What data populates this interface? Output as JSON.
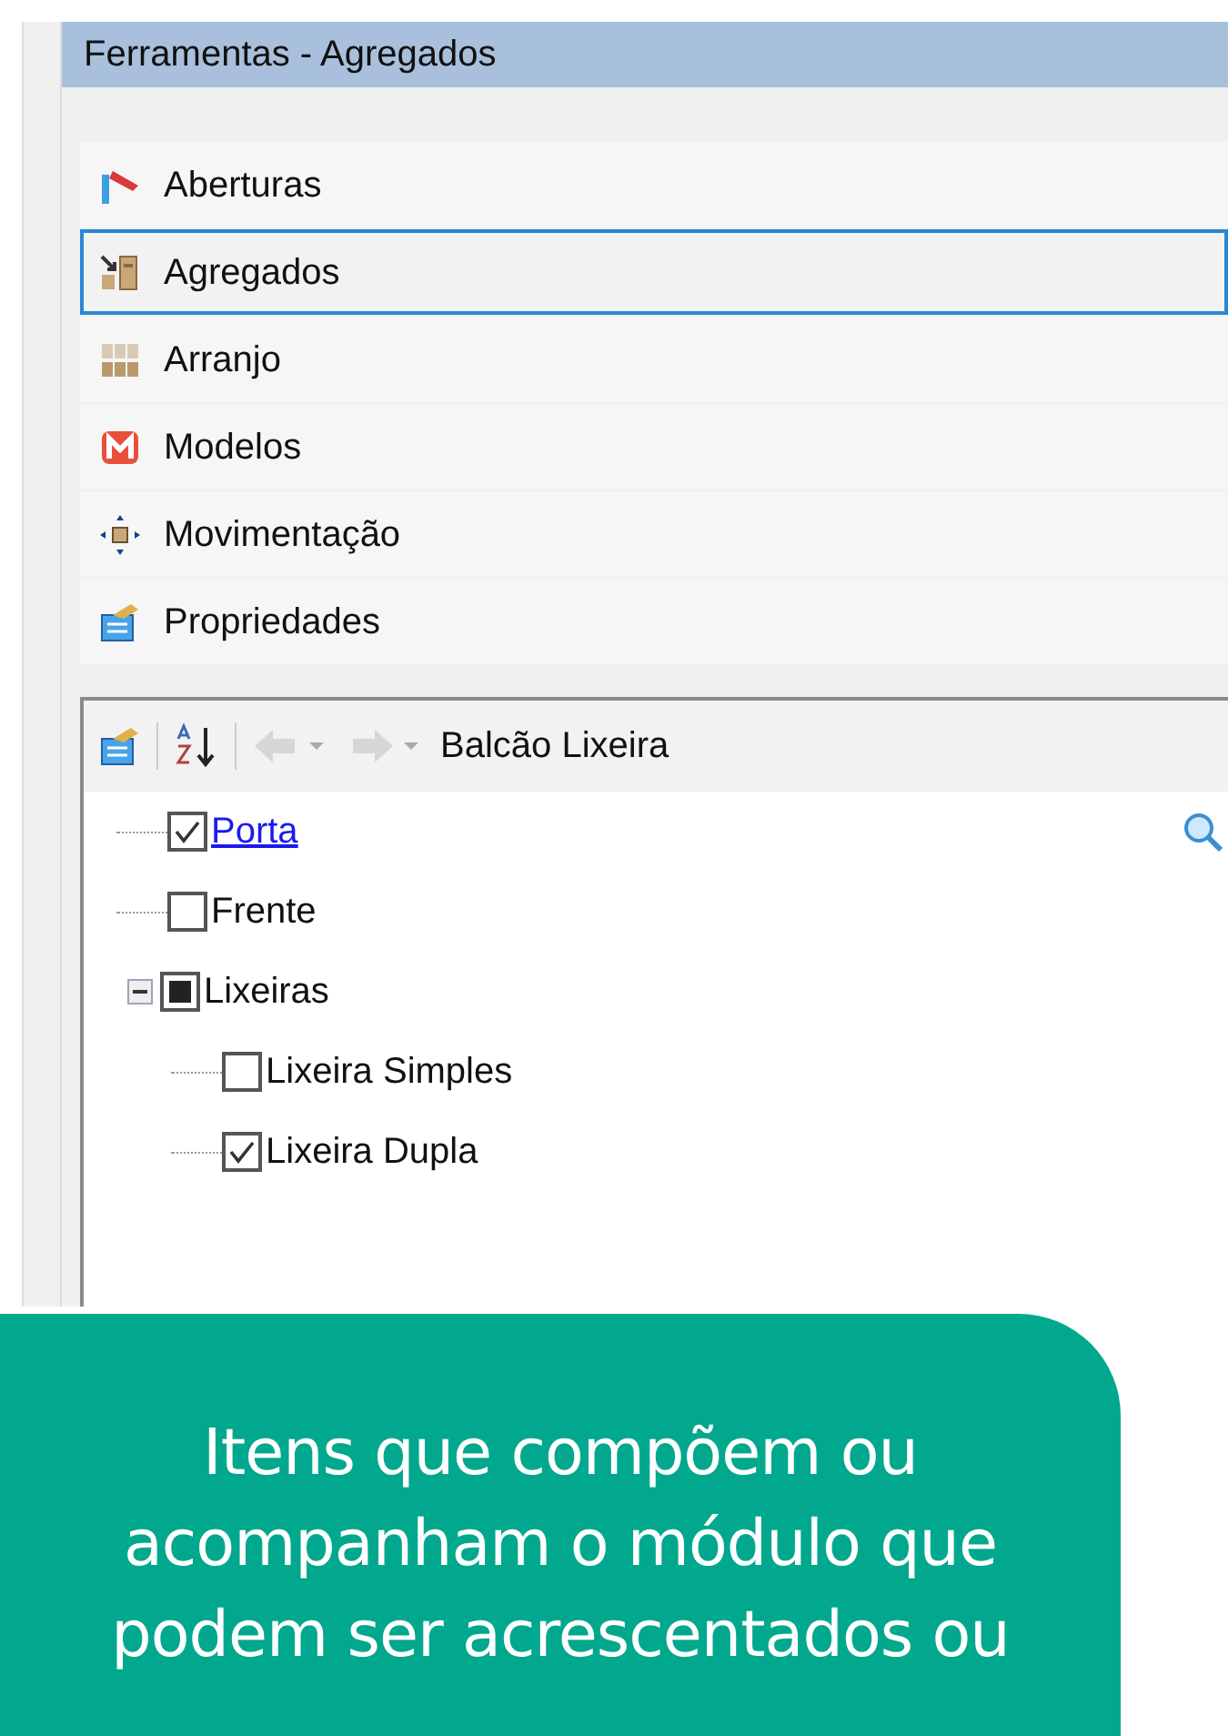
{
  "panel": {
    "title": "Ferramentas - Agregados"
  },
  "tools": [
    {
      "label": "Aberturas",
      "kind": "flag",
      "selected": false
    },
    {
      "label": "Agregados",
      "kind": "aggregate",
      "selected": true
    },
    {
      "label": "Arranjo",
      "kind": "grid",
      "selected": false
    },
    {
      "label": "Modelos",
      "kind": "m",
      "selected": false
    },
    {
      "label": "Movimentação",
      "kind": "move",
      "selected": false
    },
    {
      "label": "Propriedades",
      "kind": "props",
      "selected": false
    }
  ],
  "tree_toolbar": {
    "path": "Balcão Lixeira"
  },
  "tree": [
    {
      "label": "Porta",
      "kind": "link",
      "checked": true,
      "indeterminate": false
    },
    {
      "label": "Frente",
      "kind": "plain",
      "checked": false,
      "indeterminate": false
    },
    {
      "label": "Lixeiras",
      "kind": "plain",
      "checked": false,
      "indeterminate": true,
      "expanded": true,
      "children": [
        {
          "label": "Lixeira Simples",
          "kind": "plain",
          "checked": false,
          "indeterminate": false
        },
        {
          "label": "Lixeira Dupla",
          "kind": "plain",
          "checked": true,
          "indeterminate": false
        }
      ]
    }
  ],
  "callout": {
    "text": "Itens que compõem ou\nacompanham o módulo que\npodem ser acrescentados ou"
  }
}
